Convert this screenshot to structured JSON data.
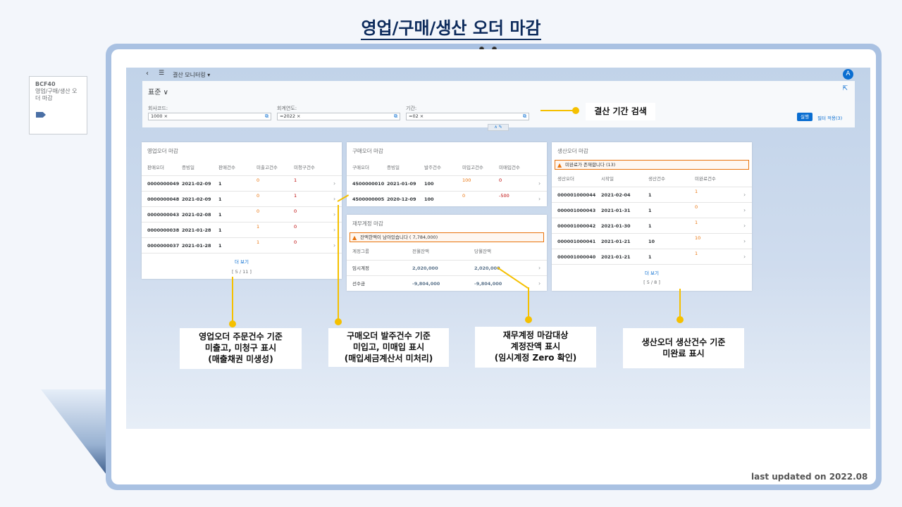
{
  "page_title": "영업/구매/생산 오더 마감",
  "side_card": {
    "code": "BCF40",
    "title": "영업/구매/생산 오더 마감"
  },
  "shell": {
    "app_title": "결산 모니터링 ▾",
    "avatar": "A"
  },
  "filter": {
    "variant": "표준 ∨",
    "fields": [
      {
        "label": "회사코드:",
        "token": "1000 ×"
      },
      {
        "label": "회계연도:",
        "token": "=2022 ×"
      },
      {
        "label": "기간:",
        "token": "=02 ×"
      }
    ],
    "go": "실행",
    "adapt": "필터 적용(3)"
  },
  "sales": {
    "title": "영업오더 마감",
    "headers": [
      "판매오더",
      "증빙일",
      "판매건수",
      "미출고건수",
      "미청구건수"
    ],
    "rows": [
      [
        "0000000049",
        "2021-02-09",
        "1",
        "0",
        "1"
      ],
      [
        "0000000048",
        "2021-02-09",
        "1",
        "0",
        "1"
      ],
      [
        "0000000043",
        "2021-02-08",
        "1",
        "0",
        "0"
      ],
      [
        "0000000038",
        "2021-01-28",
        "1",
        "1",
        "0"
      ],
      [
        "0000000037",
        "2021-01-28",
        "1",
        "1",
        "0"
      ]
    ],
    "more": "더 보기",
    "count": "[ 5 / 11 ]"
  },
  "purchase": {
    "title": "구매오더 마감",
    "headers": [
      "구매오더",
      "증빙일",
      "발주건수",
      "미입고건수",
      "미매입건수"
    ],
    "rows": [
      [
        "4500000010",
        "2021-01-09",
        "100",
        "100",
        "0"
      ],
      [
        "4500000005",
        "2020-12-09",
        "100",
        "0",
        "-500"
      ]
    ]
  },
  "finance": {
    "title": "재무계정 마감",
    "message": "잔액한액이 남아있습니다 ( 7,784,000)",
    "headers": [
      "계정그룹",
      "전월잔액",
      "당월잔액"
    ],
    "rows": [
      [
        "임시계정",
        "2,020,000",
        "2,020,000"
      ],
      [
        "선수금",
        "-9,804,000",
        "-9,804,000"
      ]
    ]
  },
  "production": {
    "title": "생산오더 마감",
    "message": "미완료가 존재합니다 (13)",
    "headers": [
      "생산오더",
      "시작일",
      "생산건수",
      "미완료건수"
    ],
    "rows": [
      [
        "000001000044",
        "2021-02-04",
        "1",
        "1"
      ],
      [
        "000001000043",
        "2021-01-31",
        "1",
        "0"
      ],
      [
        "000001000042",
        "2021-01-30",
        "1",
        "1"
      ],
      [
        "000001000041",
        "2021-01-21",
        "10",
        "10"
      ],
      [
        "000001000040",
        "2021-01-21",
        "1",
        "1"
      ]
    ],
    "more": "더 보기",
    "count": "[ 5 / 8 ]"
  },
  "callouts": {
    "period": "결산 기간 검색",
    "sales": "영업오더 주문건수 기준\n미출고, 미청구 표시\n(매출채권 미생성)",
    "purchase": "구매오더 발주건수 기준\n미입고, 미매입 표시\n(매입세금계산서 미처리)",
    "finance": "재무계정 마감대상\n계정잔액 표시\n(임시계정 Zero 확인)",
    "production": "생산오더 생산건수 기준\n미완료 표시"
  },
  "footer": "last updated on 2022.08",
  "colors": {
    "accent": "#0a6ed1",
    "highlight": "#f5c000",
    "warning": "#e9730c",
    "negative": "#bb0000",
    "frame": "#a9c1e2"
  }
}
